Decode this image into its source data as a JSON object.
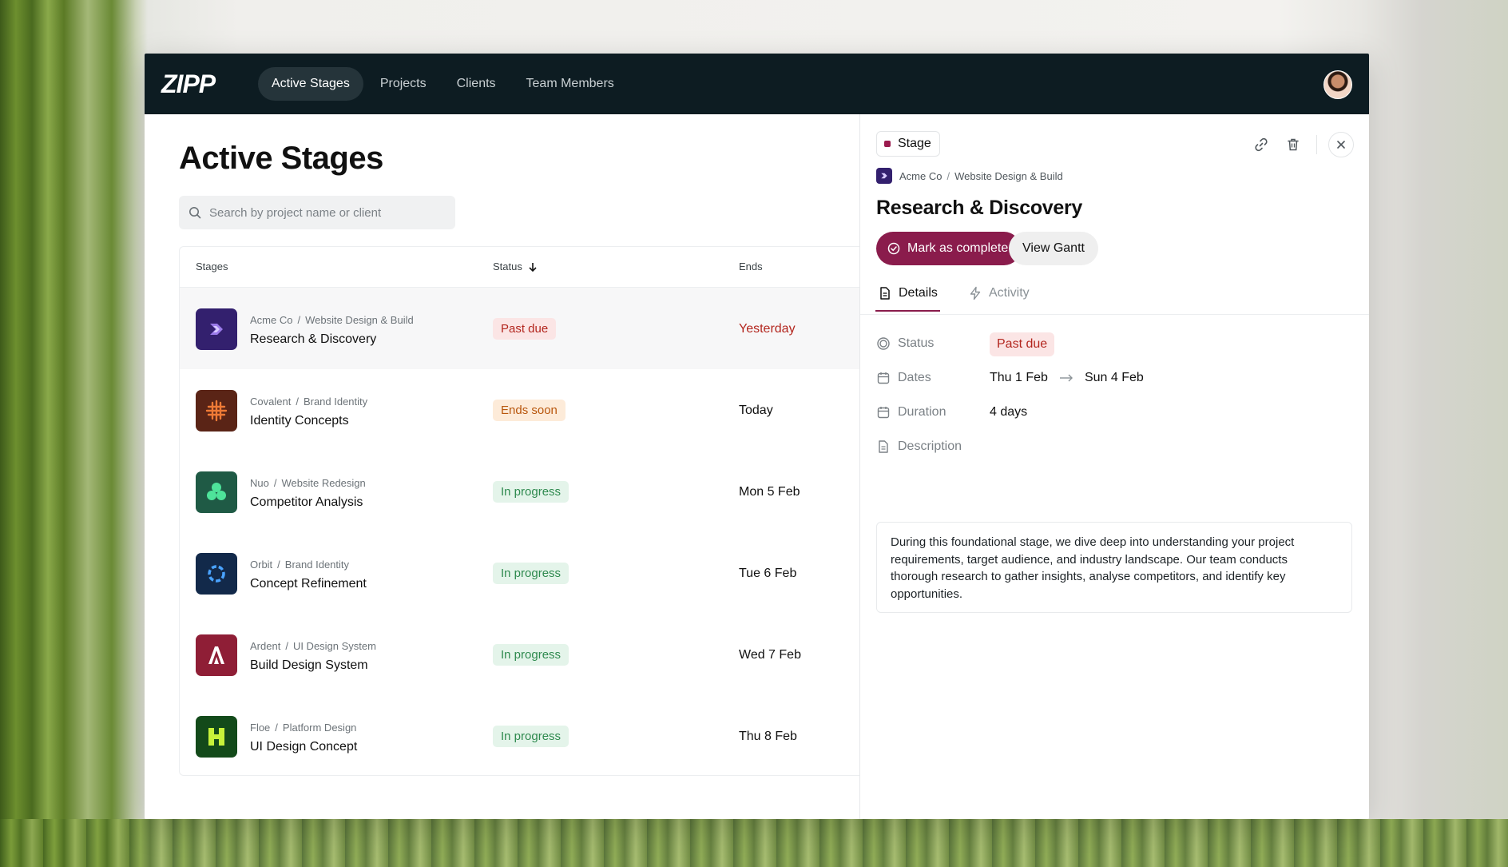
{
  "app": {
    "logo": "ZIPP",
    "nav": [
      "Active Stages",
      "Projects",
      "Clients",
      "Team Members"
    ],
    "active_nav": "Active Stages"
  },
  "main": {
    "title": "Active Stages",
    "search_placeholder": "Search by project name or client",
    "columns": {
      "stages": "Stages",
      "status": "Status",
      "ends": "Ends"
    },
    "rows": [
      {
        "client": "Acme Co",
        "project": "Website Design & Build",
        "stage": "Research & Discovery",
        "status": "Past due",
        "ends": "Yesterday"
      },
      {
        "client": "Covalent",
        "project": "Brand Identity",
        "stage": "Identity Concepts",
        "status": "Ends soon",
        "ends": "Today"
      },
      {
        "client": "Nuo",
        "project": "Website Redesign",
        "stage": "Competitor Analysis",
        "status": "In progress",
        "ends": "Mon 5 Feb"
      },
      {
        "client": "Orbit",
        "project": "Brand Identity",
        "stage": "Concept Refinement",
        "status": "In progress",
        "ends": "Tue 6 Feb"
      },
      {
        "client": "Ardent",
        "project": "UI Design System",
        "stage": "Build Design System",
        "status": "In progress",
        "ends": "Wed 7 Feb"
      },
      {
        "client": "Floe",
        "project": "Platform Design",
        "stage": "UI Design Concept",
        "status": "In progress",
        "ends": "Thu 8 Feb"
      }
    ]
  },
  "panel": {
    "tag": "Stage",
    "client": "Acme Co",
    "project": "Website Design & Build",
    "title": "Research & Discovery",
    "complete_label": "Mark as complete",
    "gantt_label": "View Gantt",
    "tabs": {
      "details": "Details",
      "activity": "Activity"
    },
    "labels": {
      "status": "Status",
      "dates": "Dates",
      "duration": "Duration",
      "description": "Description"
    },
    "status": "Past due",
    "start": "Thu 1 Feb",
    "end": "Sun 4 Feb",
    "duration": "4 days",
    "description": "During this foundational stage, we dive deep into understanding your project requirements, target audience, and industry landscape. Our team conducts thorough research to gather insights, analyse competitors, and identify key opportunities."
  },
  "colors": {
    "nav_bg": "#0d1c22",
    "accent": "#8a1c4c",
    "past_due": "#b3261e",
    "ends_soon": "#b8560c",
    "in_progress": "#2f8a4f"
  },
  "icons": {
    "search": "search-icon",
    "sort": "arrow-down-icon",
    "link": "link-icon",
    "delete": "trash-icon",
    "close": "close-icon",
    "complete": "check-circle-icon",
    "details": "document-icon",
    "activity": "lightning-icon",
    "status": "status-ring-icon",
    "dates": "calendar-icon",
    "duration": "calendar-icon",
    "description": "document-icon"
  }
}
